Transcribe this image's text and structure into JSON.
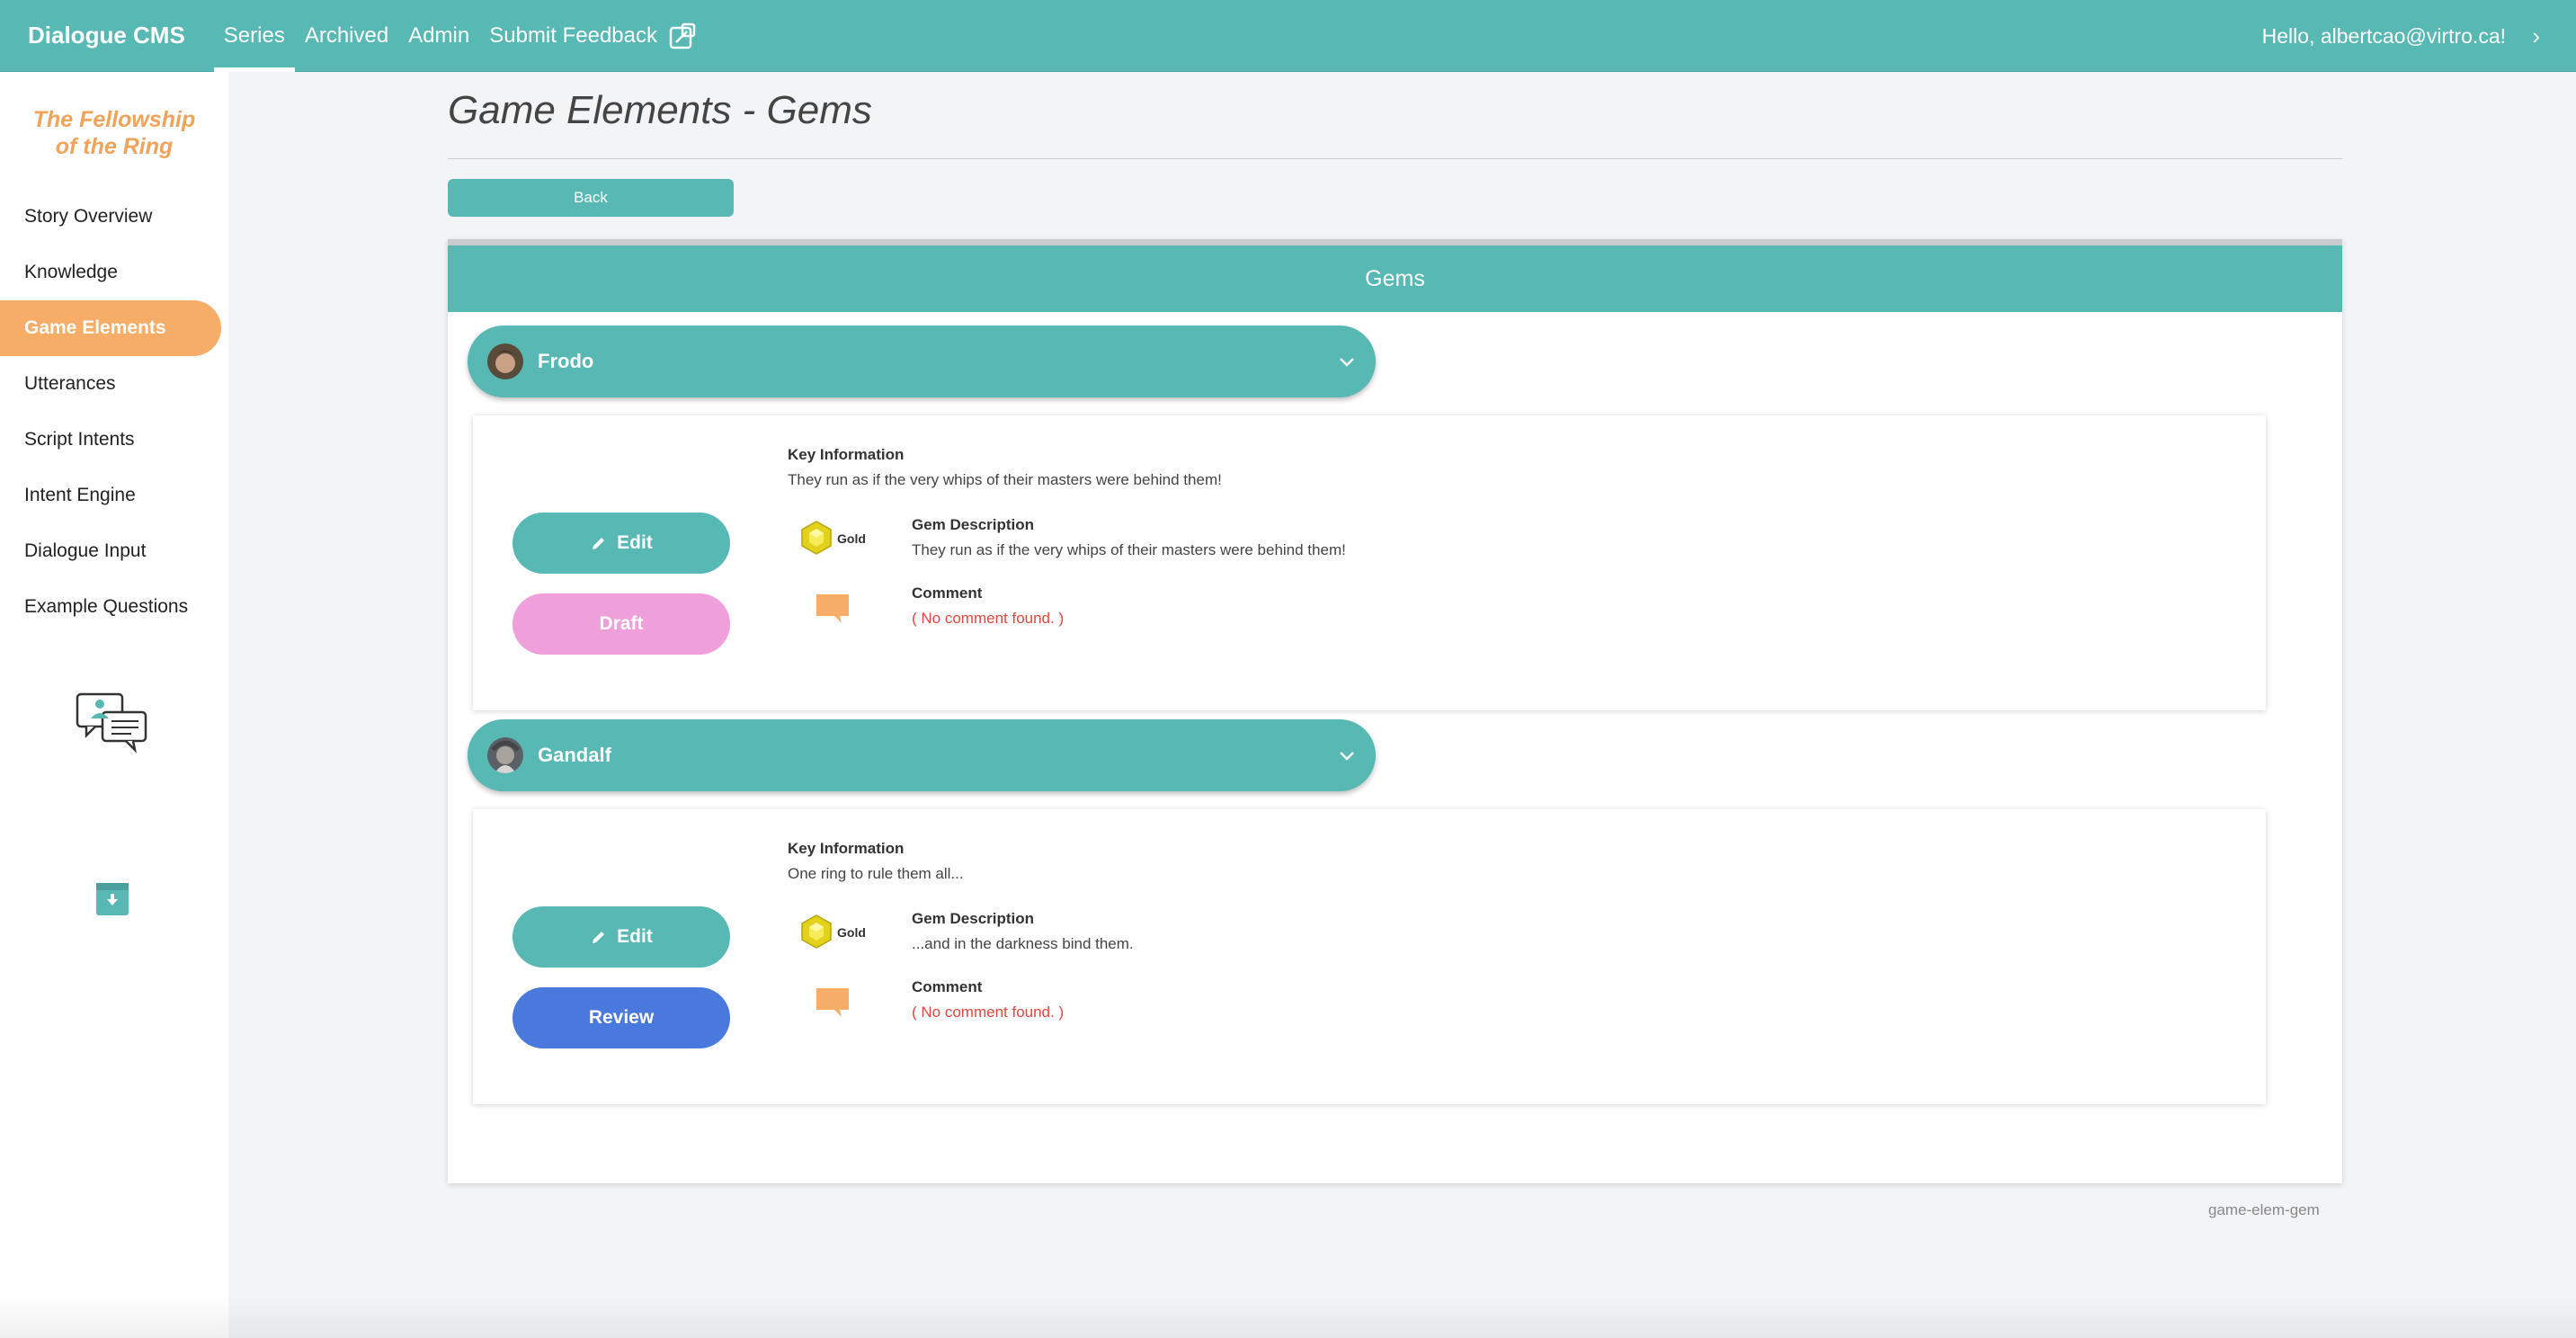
{
  "header": {
    "brand": "Dialogue CMS",
    "nav": [
      "Series",
      "Archived",
      "Admin",
      "Submit Feedback"
    ],
    "greeting": "Hello, albertcao@virtro.ca!",
    "accent_color": "#57b8b4"
  },
  "sidebar": {
    "story_title_line1": "The Fellowship",
    "story_title_line2": "of the Ring",
    "items": [
      "Story Overview",
      "Knowledge",
      "Game Elements",
      "Utterances",
      "Script Intents",
      "Intent Engine",
      "Dialogue Input",
      "Example Questions"
    ],
    "active_item": "Game Elements",
    "icons": [
      "chat-users-icon",
      "archive-download-icon"
    ]
  },
  "main": {
    "title": "Game Elements - Gems",
    "back_label": "Back",
    "card_header": "Gems",
    "footer_tag": "game-elem-gem"
  },
  "gems": [
    {
      "character": "Frodo",
      "key_info_label": "Key Information",
      "key_info": "They run as if the very whips of their masters were behind them!",
      "gem_type": "Gold",
      "gem_desc_label": "Gem Description",
      "gem_desc": "They run as if the very whips of their masters were behind them!",
      "comment_label": "Comment",
      "comment": "( No comment found. )",
      "edit_label": "Edit",
      "status_label": "Draft",
      "status_color": "#ef9fd9"
    },
    {
      "character": "Gandalf",
      "key_info_label": "Key Information",
      "key_info": "One ring to rule them all...",
      "gem_type": "Gold",
      "gem_desc_label": "Gem Description",
      "gem_desc": "...and in the darkness bind them.",
      "comment_label": "Comment",
      "comment": "( No comment found. )",
      "edit_label": "Edit",
      "status_label": "Review",
      "status_color": "#4979dd"
    }
  ]
}
